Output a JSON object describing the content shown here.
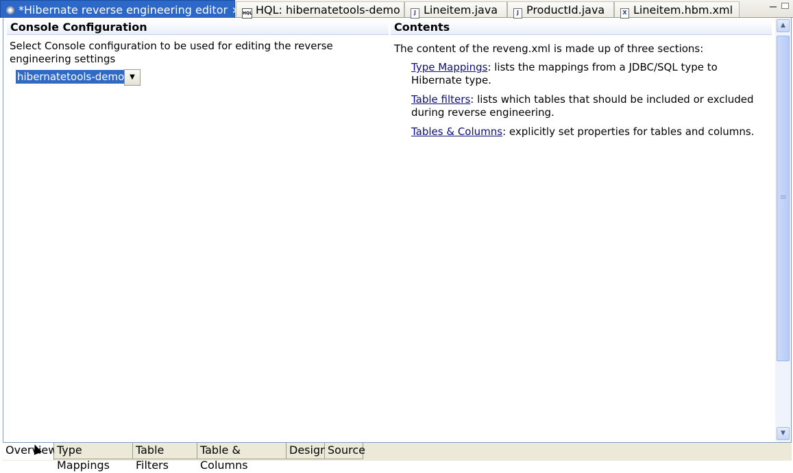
{
  "tabs": [
    {
      "label": "*Hibernate reverse engineering editor",
      "close": "✕",
      "icon": "reveng-icon"
    },
    {
      "label": "HQL: hibernatetools-demo",
      "icon": "hql-icon"
    },
    {
      "label": "Lineitem.java",
      "icon": "java-file-icon"
    },
    {
      "label": "ProductId.java",
      "icon": "java-file-icon"
    },
    {
      "label": "Lineitem.hbm.xml",
      "icon": "xml-file-icon"
    }
  ],
  "console_section": {
    "title": "Console Configuration",
    "description": "Select Console configuration to be used for editing the reverse engineering settings",
    "selected_value": "hibernatetools-demo",
    "dropdown_arrow": "▼"
  },
  "contents_section": {
    "title": "Contents",
    "intro": "The content of the reveng.xml is made up of three sections:",
    "items": [
      {
        "link": "Type Mappings",
        "text": ": lists the mappings from a JDBC/SQL type to Hibernate type."
      },
      {
        "link": "Table filters",
        "text": ": lists which tables that should be included or excluded during reverse engineering."
      },
      {
        "link": "Tables & Columns",
        "text": ": explicitly set properties for tables and columns."
      }
    ]
  },
  "scrollbar": {
    "up": "▲",
    "down": "▼"
  },
  "page_tabs": [
    {
      "label": "Overview",
      "active": true
    },
    {
      "label": "Type Mappings"
    },
    {
      "label": "Table Filters"
    },
    {
      "label": "Table & Columns"
    },
    {
      "label": "Design"
    },
    {
      "label": "Source"
    }
  ],
  "colors": {
    "active_tab": "#2d68c9",
    "selection": "#316ac5",
    "link": "#0b0b80"
  }
}
